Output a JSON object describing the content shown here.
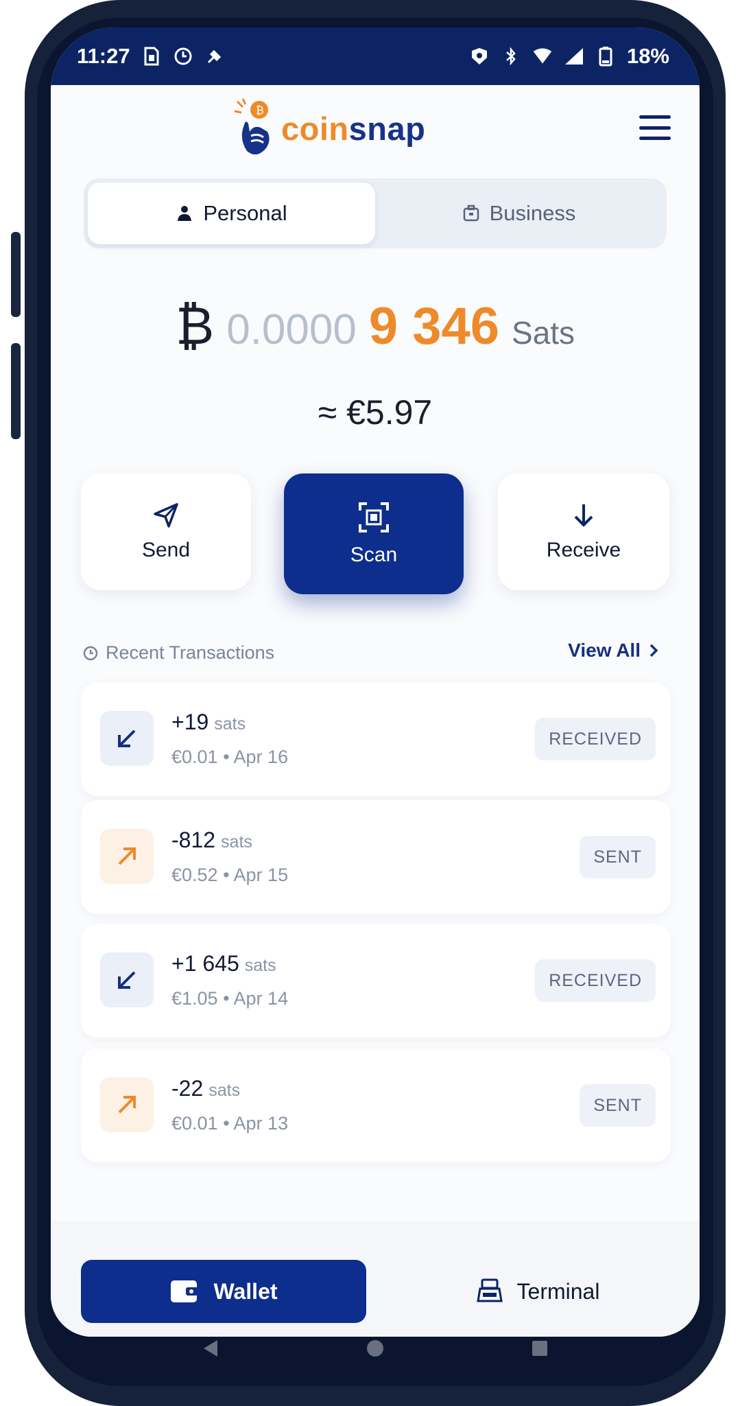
{
  "status_bar": {
    "time": "11:27",
    "battery": "18%"
  },
  "header": {
    "logo_coin": "coin",
    "logo_snap": "snap"
  },
  "account_toggle": {
    "personal": "Personal",
    "business": "Business",
    "selected": "Personal"
  },
  "balance": {
    "dim_digits": "0.0000",
    "main_digits": "9 346",
    "unit": "Sats",
    "fiat": "≈ €5.97"
  },
  "actions": {
    "send": "Send",
    "scan": "Scan",
    "receive": "Receive"
  },
  "recent": {
    "title": "Recent Transactions",
    "view_all": "View All"
  },
  "transactions": [
    {
      "amount": "+19",
      "unit": "sats",
      "meta": "€0.01 • Apr 16",
      "status": "RECEIVED",
      "direction": "in"
    },
    {
      "amount": "-812",
      "unit": "sats",
      "meta": "€0.52 • Apr 15",
      "status": "SENT",
      "direction": "out"
    },
    {
      "amount": "+1 645",
      "unit": "sats",
      "meta": "€1.05 • Apr 14",
      "status": "RECEIVED",
      "direction": "in"
    },
    {
      "amount": "-22",
      "unit": "sats",
      "meta": "€0.01 • Apr 13",
      "status": "SENT",
      "direction": "out"
    }
  ],
  "bottom_nav": {
    "wallet": "Wallet",
    "terminal": "Terminal",
    "active": "Wallet"
  },
  "colors": {
    "navy": "#0d2e8c",
    "orange": "#ee8a2a",
    "status_bar": "#0d2464"
  },
  "icons": [
    "bitcoin-icon",
    "send-icon",
    "scan-icon",
    "receive-icon",
    "arrow-in-icon",
    "arrow-out-icon",
    "wallet-icon",
    "terminal-icon",
    "menu-icon"
  ]
}
